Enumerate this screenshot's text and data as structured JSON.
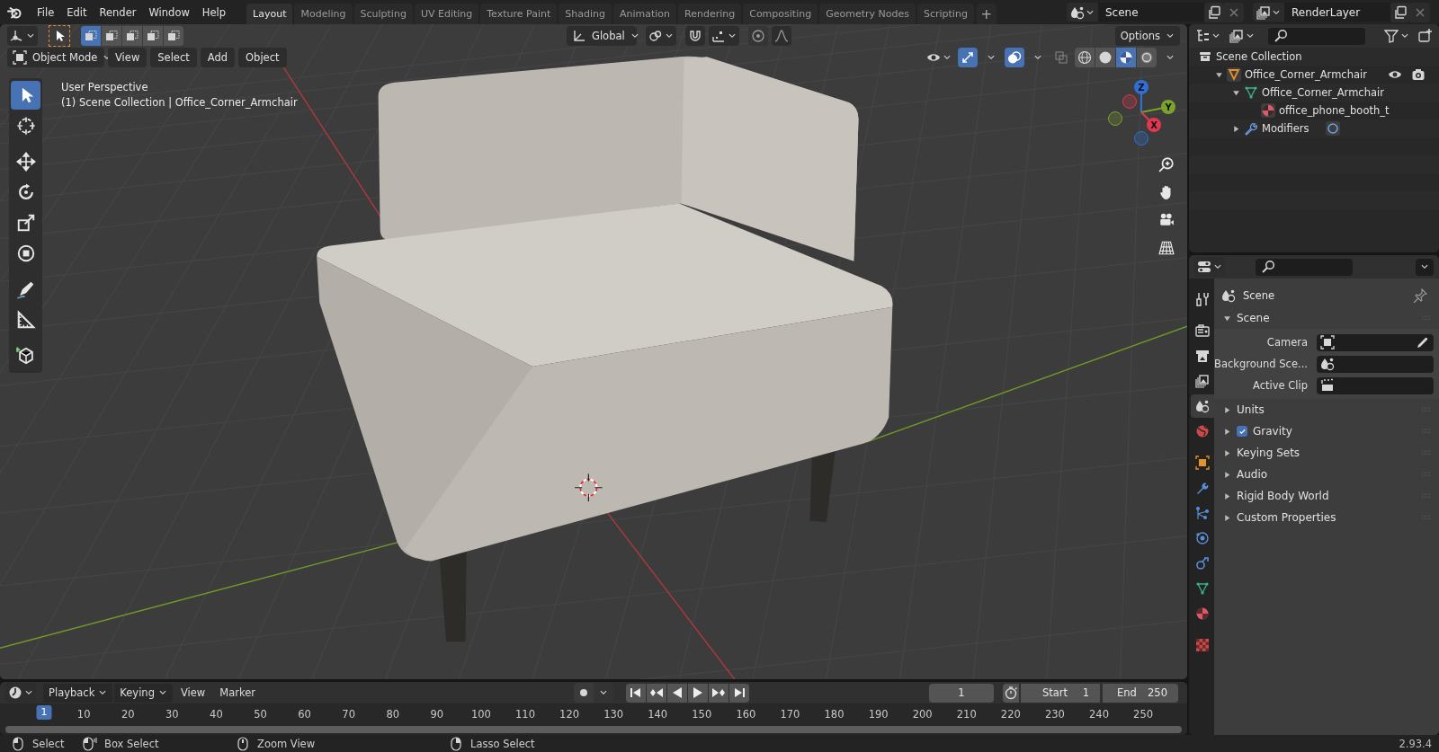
{
  "top_bar": {
    "menus": [
      "File",
      "Edit",
      "Render",
      "Window",
      "Help"
    ],
    "workspace_tabs": [
      {
        "label": "Layout",
        "selected": true
      },
      {
        "label": "Modeling",
        "selected": false
      },
      {
        "label": "Sculpting",
        "selected": false
      },
      {
        "label": "UV Editing",
        "selected": false
      },
      {
        "label": "Texture Paint",
        "selected": false
      },
      {
        "label": "Shading",
        "selected": false
      },
      {
        "label": "Animation",
        "selected": false
      },
      {
        "label": "Rendering",
        "selected": false
      },
      {
        "label": "Compositing",
        "selected": false
      },
      {
        "label": "Geometry Nodes",
        "selected": false
      },
      {
        "label": "Scripting",
        "selected": false
      }
    ],
    "add_tab": "+",
    "scene": "Scene",
    "view_layer": "RenderLayer"
  },
  "viewport": {
    "select_modes": [
      {
        "selected": true
      },
      {
        "selected": false
      },
      {
        "selected": false
      },
      {
        "selected": false
      },
      {
        "selected": false
      }
    ],
    "orientation": "Global",
    "options": "Options",
    "mode": "Object Mode",
    "menus": [
      "View",
      "Select",
      "Add",
      "Object"
    ],
    "overlay_lines": [
      "User Perspective",
      "(1) Scene Collection | Office_Corner_Armchair"
    ],
    "shading": [
      {
        "kind": "wireframe",
        "selected": false
      },
      {
        "kind": "solid",
        "selected": false
      },
      {
        "kind": "material",
        "selected": true
      },
      {
        "kind": "rendered",
        "selected": false
      }
    ],
    "tools": [
      {
        "kind": "select",
        "selected": true
      },
      {
        "kind": "cursor",
        "selected": false
      },
      {
        "kind": "move",
        "selected": false
      },
      {
        "kind": "rotate",
        "selected": false
      },
      {
        "kind": "scale",
        "selected": false
      },
      {
        "kind": "transform",
        "selected": false
      },
      {
        "kind": "annotate",
        "selected": false
      },
      {
        "kind": "measure",
        "selected": false
      },
      {
        "kind": "add-cube",
        "selected": false
      }
    ],
    "gizmo_axes": [
      {
        "label": "Z",
        "color": "#2f6fd6"
      },
      {
        "label": "Y",
        "color": "#7aa32a"
      },
      {
        "label": "X",
        "color": "#e0384e"
      }
    ]
  },
  "outliner": {
    "items": [
      {
        "label": "Scene Collection",
        "kind": "collection",
        "children": [
          {
            "label": "Office_Corner_Armchair",
            "kind": "object",
            "expanded": true,
            "children": [
              {
                "label": "Office_Corner_Armchair",
                "kind": "mesh",
                "expanded": true,
                "children": [
                  {
                    "label": "office_phone_booth_t",
                    "kind": "material"
                  }
                ]
              },
              {
                "label": "Modifiers",
                "kind": "modifiers",
                "expanded": false
              }
            ]
          }
        ]
      }
    ]
  },
  "properties": {
    "tabs": [
      {
        "kind": "tool",
        "selected": false
      },
      {
        "kind": "render",
        "selected": false
      },
      {
        "kind": "output",
        "selected": false
      },
      {
        "kind": "view-layer",
        "selected": false
      },
      {
        "kind": "scene",
        "selected": true
      },
      {
        "kind": "world",
        "selected": false
      },
      {
        "kind": "object",
        "selected": false
      },
      {
        "kind": "modifiers",
        "selected": false
      },
      {
        "kind": "particles",
        "selected": false
      },
      {
        "kind": "physics",
        "selected": false
      },
      {
        "kind": "constraints",
        "selected": false
      },
      {
        "kind": "data",
        "selected": false
      },
      {
        "kind": "material",
        "selected": false
      },
      {
        "kind": "texture",
        "selected": false
      }
    ],
    "context": "Scene",
    "panels": [
      {
        "label": "Scene",
        "expanded": true,
        "fields": [
          {
            "label": "Camera",
            "kind": "camera"
          },
          {
            "label": "Background Sce...",
            "kind": "scene"
          },
          {
            "label": "Active Clip",
            "kind": "clip"
          }
        ]
      },
      {
        "label": "Units",
        "expanded": false
      },
      {
        "label": "Gravity",
        "expanded": false,
        "checked": true
      },
      {
        "label": "Keying Sets",
        "expanded": false
      },
      {
        "label": "Audio",
        "expanded": false
      },
      {
        "label": "Rigid Body World",
        "expanded": false
      },
      {
        "label": "Custom Properties",
        "expanded": false
      }
    ]
  },
  "timeline": {
    "menus": [
      {
        "label": "Playback",
        "kind": "dropdown"
      },
      {
        "label": "Keying",
        "kind": "dropdown"
      },
      {
        "label": "View",
        "kind": "menu"
      },
      {
        "label": "Marker",
        "kind": "menu"
      }
    ],
    "current_frame": "1",
    "start_label": "Start",
    "start": "1",
    "end_label": "End",
    "end": "250",
    "playhead": "1",
    "ruler_labels": [
      "10",
      "20",
      "30",
      "40",
      "50",
      "60",
      "70",
      "80",
      "90",
      "100",
      "110",
      "120",
      "130",
      "140",
      "150",
      "160",
      "170",
      "180",
      "190",
      "200",
      "210",
      "220",
      "230",
      "240",
      "250"
    ]
  },
  "status_bar": {
    "hints": [
      {
        "label": "Select",
        "kind": "left"
      },
      {
        "label": "Box Select",
        "kind": "drag"
      },
      {
        "label": "Zoom View",
        "kind": "middle"
      },
      {
        "label": "Lasso Select",
        "kind": "right"
      }
    ],
    "version": "2.93.4"
  }
}
